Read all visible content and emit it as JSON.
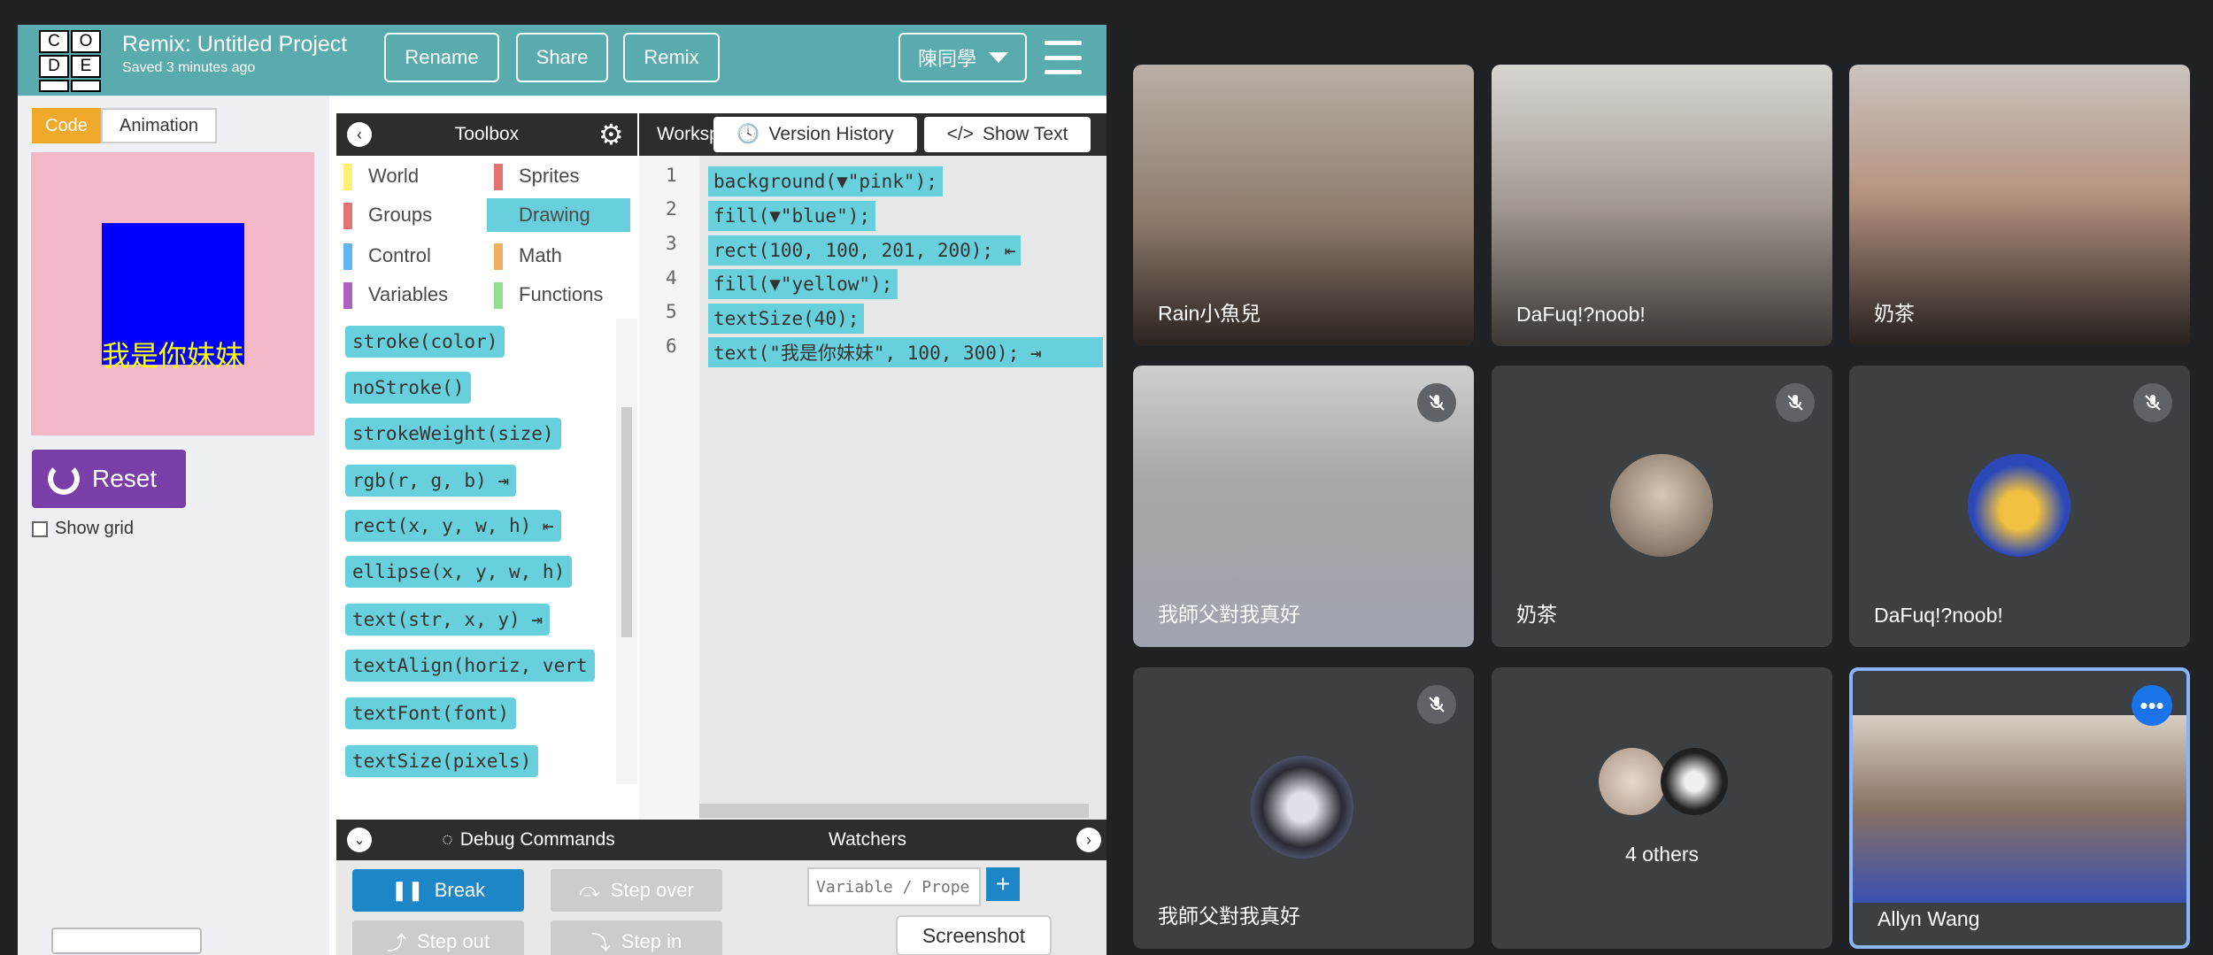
{
  "editor": {
    "logo_letters": [
      "C",
      "O",
      "D",
      "E",
      "",
      ""
    ],
    "project_title": "Remix: Untitled Project",
    "saved_text": "Saved 3 minutes ago",
    "buttons": {
      "rename": "Rename",
      "share": "Share",
      "remix": "Remix"
    },
    "user": "陳同學",
    "tabs": {
      "code": "Code",
      "animation": "Animation"
    },
    "canvas_text": "我是你妹妹",
    "reset_label": "Reset",
    "show_grid_label": "Show grid",
    "toolbox_title": "Toolbox",
    "workspace_title": "Workspace",
    "version_history_label": "Version History",
    "show_text_label": "Show Text",
    "categories": [
      {
        "label": "World",
        "color": "#fff176"
      },
      {
        "label": "Sprites",
        "color": "#e57373"
      },
      {
        "label": "Groups",
        "color": "#e57373"
      },
      {
        "label": "Drawing",
        "color": "#68d0dc"
      },
      {
        "label": "Control",
        "color": "#64b5f6"
      },
      {
        "label": "Math",
        "color": "#f0b060"
      },
      {
        "label": "Variables",
        "color": "#b060c0"
      },
      {
        "label": "Functions",
        "color": "#90e090"
      }
    ],
    "blocks": [
      "stroke(color)",
      "noStroke()",
      "strokeWeight(size)",
      "rgb(r, g, b) ⇥",
      "rect(x, y, w, h) ⇤",
      "ellipse(x, y, w, h)",
      "text(str, x, y) ⇥",
      "textAlign(horiz, vert",
      "textFont(font)",
      "textSize(pixels)"
    ],
    "code_lines": [
      "background(▼\"pink\");",
      "fill(▼\"blue\");",
      "rect(100, 100, 201, 200); ⇤",
      "fill(▼\"yellow\");",
      "textSize(40);",
      "text(\"我是你妹妹\", 100, 300); ⇥"
    ],
    "line_numbers": [
      "1",
      "2",
      "3",
      "4",
      "5",
      "6"
    ],
    "debug_title": "Debug Commands",
    "watchers_title": "Watchers",
    "debug_buttons": {
      "break": "Break",
      "step_over": "Step over",
      "step_out": "Step out",
      "step_in": "Step in"
    },
    "variable_placeholder": "Variable / Property",
    "plus": "+",
    "screenshot_label": "Screenshot"
  },
  "meet": {
    "tiles": [
      {
        "name": "Rain小魚兒",
        "muted": false
      },
      {
        "name": "DaFuq!?noob!",
        "muted": false
      },
      {
        "name": "奶茶",
        "muted": false
      },
      {
        "name": "我師父對我真好",
        "muted": true
      },
      {
        "name": "奶茶",
        "muted": true
      },
      {
        "name": "DaFuq!?noob!",
        "muted": true
      },
      {
        "name": "我師父對我真好",
        "muted": true
      },
      {
        "name": "4 others",
        "muted": false
      },
      {
        "name": "Allyn Wang",
        "muted": false
      }
    ],
    "colors": {
      "tile_bg": "#3c4043",
      "active_border": "#8ab4f8",
      "more_button": "#1a73e8"
    }
  }
}
